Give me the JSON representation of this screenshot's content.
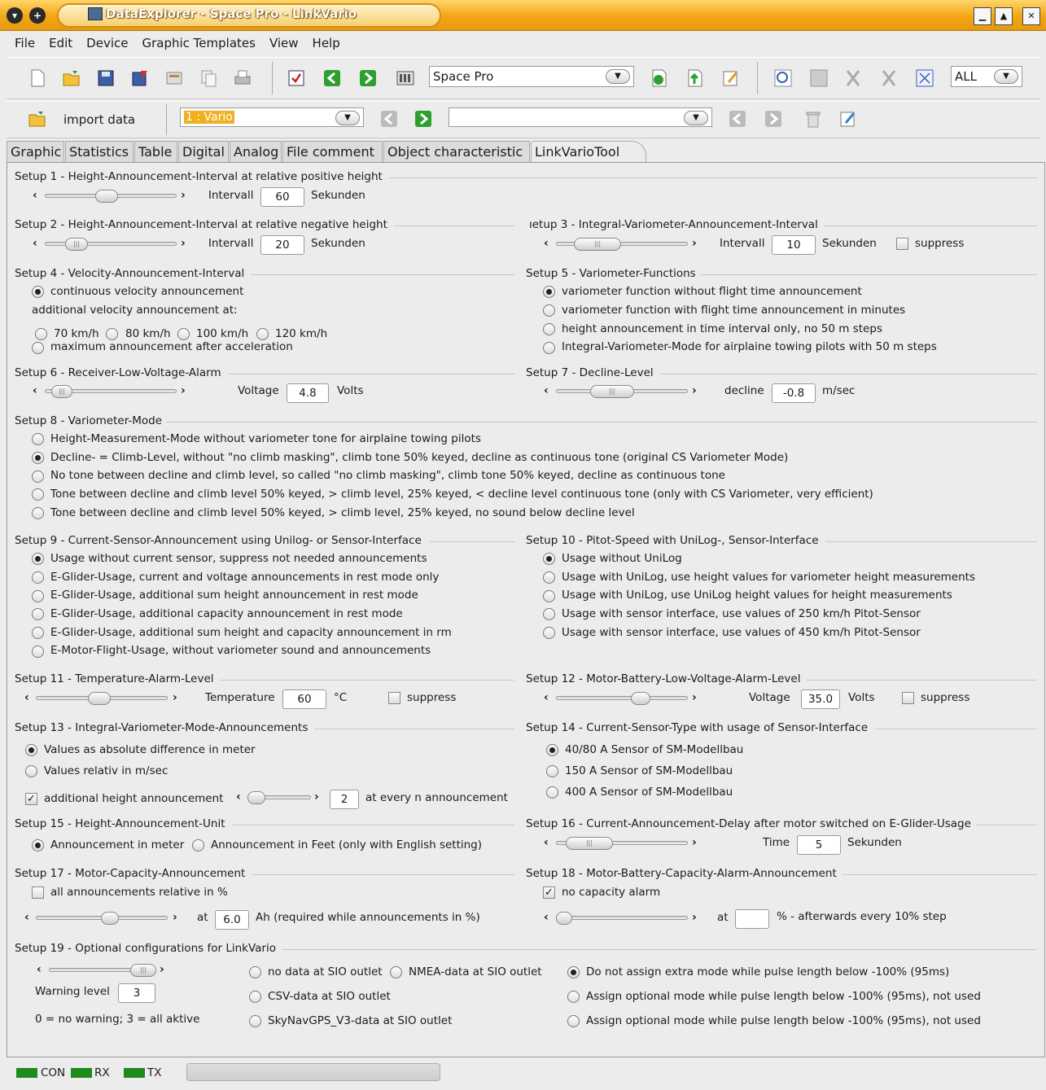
{
  "window": {
    "title": "DataExplorer  -  Space Pro  -  LinkVario"
  },
  "menu": [
    "File",
    "Edit",
    "Device",
    "Graphic Templates",
    "View",
    "Help"
  ],
  "toolbar": {
    "device_combo": "Space Pro",
    "filter_combo": "ALL"
  },
  "toolbar2": {
    "import_label": "import data",
    "channel_combo": "1 : Vario",
    "record_combo": ""
  },
  "tabs": [
    "Graphic",
    "Statistics",
    "Table",
    "Digital",
    "Analog",
    "File comment",
    "Object characteristic",
    "LinkVarioTool"
  ],
  "setup1": {
    "title": "Setup 1 - Height-Announcement-Interval at relative positive height",
    "label": "Intervall",
    "value": "60",
    "unit": "Sekunden"
  },
  "setup2": {
    "title": "Setup 2 - Height-Announcement-Interval at relative negative height",
    "label": "Intervall",
    "value": "20",
    "unit": "Sekunden"
  },
  "setup3": {
    "title": "ıetup 3 - Integral-Variometer-Announcement-Interval",
    "label": "Intervall",
    "value": "10",
    "unit": "Sekunden",
    "suppress": "suppress"
  },
  "setup4": {
    "title": "Setup 4 - Velocity-Announcement-Interval",
    "opt_continuous": "continuous velocity announcement",
    "additional": "additional velocity announcement at:",
    "speeds": [
      "70 km/h",
      "80 km/h",
      "100 km/h",
      "120 km/h"
    ],
    "opt_max": "maximum announcement after acceleration"
  },
  "setup5": {
    "title": "Setup 5 - Variometer-Functions",
    "options": [
      "variometer function without flight time announcement",
      "variometer function with flight time announcement in minutes",
      "height announcement in time interval only, no 50 m steps",
      "Integral-Variometer-Mode for airplaine towing pilots with 50 m steps"
    ]
  },
  "setup6": {
    "title": "Setup 6 - Receiver-Low-Voltage-Alarm",
    "label": "Voltage",
    "value": "4.8",
    "unit": "Volts"
  },
  "setup7": {
    "title": "Setup 7 - Decline-Level",
    "label": "decline",
    "value": "-0.8",
    "unit": "m/sec"
  },
  "setup8": {
    "title": "Setup 8 - Variometer-Mode",
    "options": [
      "Height-Measurement-Mode without variometer tone for airplaine towing pilots",
      "Decline- = Climb-Level, without \"no climb masking\", climb tone 50% keyed, decline as continuous tone (original CS Variometer Mode)",
      "No tone between decline and climb level, so called \"no climb masking\", climb tone 50% keyed, decline as continuous  tone",
      "Tone between decline and climb level 50% keyed, > climb level, 25% keyed, < decline level continuous tone (only with CS Variometer, very efficient)",
      "Tone between decline and climb level 50% keyed, > climb level, 25% keyed, no sound below decline level"
    ]
  },
  "setup9": {
    "title": "Setup 9 - Current-Sensor-Announcement using Unilog- or Sensor-Interface",
    "options": [
      "Usage without current sensor, suppress not needed announcements",
      "E-Glider-Usage, current and voltage announcements in rest mode only",
      "E-Glider-Usage, additional sum height announcement in rest mode",
      "E-Glider-Usage, additional capacity announcement in rest mode",
      "E-Glider-Usage, additional sum height and capacity announcement in rm",
      "E-Motor-Flight-Usage, without variometer sound and announcements"
    ]
  },
  "setup10": {
    "title": "Setup 10 - Pitot-Speed with UniLog-, Sensor-Interface",
    "options": [
      "Usage without UniLog",
      "Usage with UniLog, use height values for variometer height measurements",
      "Usage with UniLog, use UniLog height values for height measurements",
      "Usage with sensor interface, use values of 250 km/h Pitot-Sensor",
      "Usage with sensor interface, use values of 450 km/h Pitot-Sensor"
    ]
  },
  "setup11": {
    "title": "Setup 11 - Temperature-Alarm-Level",
    "label": "Temperature",
    "value": "60",
    "unit": "°C",
    "suppress": "suppress"
  },
  "setup12": {
    "title": "Setup 12 - Motor-Battery-Low-Voltage-Alarm-Level",
    "label": "Voltage",
    "value": "35.0",
    "unit": "Volts",
    "suppress": "suppress"
  },
  "setup13": {
    "title": "Setup 13 - Integral-Variometer-Mode-Announcements",
    "opt_abs": "Values as absolute difference in meter",
    "opt_rel": "Values relativ in m/sec",
    "additional": "additional height announcement",
    "value": "2",
    "suffix": "at every n announcement"
  },
  "setup14": {
    "title": "Setup 14 - Current-Sensor-Type with usage of Sensor-Interface",
    "options": [
      "40/80 A Sensor of SM-Modellbau",
      "150 A Sensor of SM-Modellbau",
      "400 A Sensor of SM-Modellbau"
    ]
  },
  "setup15": {
    "title": "Setup 15 - Height-Announcement-Unit",
    "opt_meter": "Announcement in meter",
    "opt_feet": "Announcement in Feet (only with English setting)"
  },
  "setup16": {
    "title": "Setup 16 - Current-Announcement-Delay after motor switched on E-Glider-Usage",
    "label": "Time",
    "value": "5",
    "unit": "Sekunden"
  },
  "setup17": {
    "title": "Setup 17 - Motor-Capacity-Announcement",
    "relative": "all announcements relative in %",
    "at": "at",
    "value": "6.0",
    "unit": "Ah  (required while announcements in %)"
  },
  "setup18": {
    "title": "Setup 18 - Motor-Battery-Capacity-Alarm-Announcement",
    "no_alarm": "no capacity alarm",
    "at": "at",
    "value": "",
    "unit": "% - afterwards every 10% step"
  },
  "setup19": {
    "title": "Setup 19 - Optional configurations for LinkVario",
    "warning_label": "Warning level",
    "warning_value": "3",
    "hint": "0 = no warning; 3 = all aktive",
    "sio": [
      "no data at SIO outlet",
      "NMEA-data at SIO outlet",
      "CSV-data at SIO outlet",
      "SkyNavGPS_V3-data at SIO outlet"
    ],
    "pulse": [
      "Do not assign extra mode while pulse length below -100% (95ms)",
      "Assign optional mode while pulse length below -100% (95ms), not used",
      "Assign optional mode while pulse length below -100% (95ms), not used"
    ]
  },
  "status": {
    "con": "CON",
    "rx": "RX",
    "tx": "TX"
  },
  "colors": {
    "title_bar": "#f3a514",
    "led": "#1c8a1c",
    "selected_combo": "#f0b020"
  }
}
